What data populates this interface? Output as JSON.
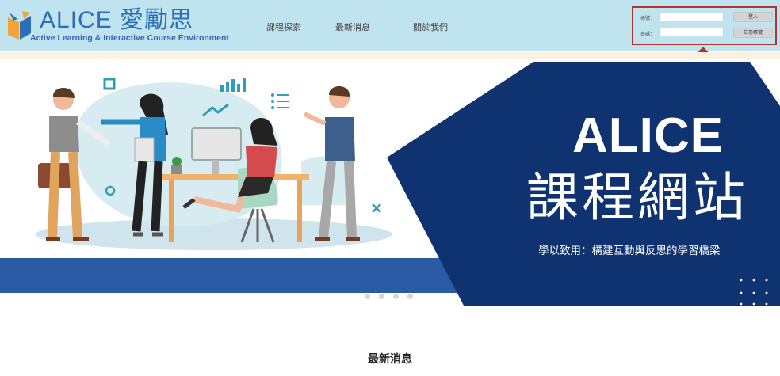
{
  "brand": {
    "title": "ALICE 愛勵思",
    "subtitle": "Active Learning & Interactive Course Environment"
  },
  "nav": [
    "課程探索",
    "最新消息",
    "關於我們"
  ],
  "login": {
    "account_label": "帳號：",
    "password_label": "密碼：",
    "login_button": "登入",
    "register_button": "註冊帳號"
  },
  "hero": {
    "title_en": "ALICE",
    "title_zh": "課程網站",
    "tagline": "學以致用：構建互動與反思的學習橋梁",
    "slide_count": 4
  },
  "sections": {
    "news_title": "最新消息"
  },
  "colors": {
    "header_bg": "#bfe3ef",
    "hero_navy": "#0f3370",
    "hero_band": "#2a5aa4",
    "highlight_border": "#b3342a"
  }
}
